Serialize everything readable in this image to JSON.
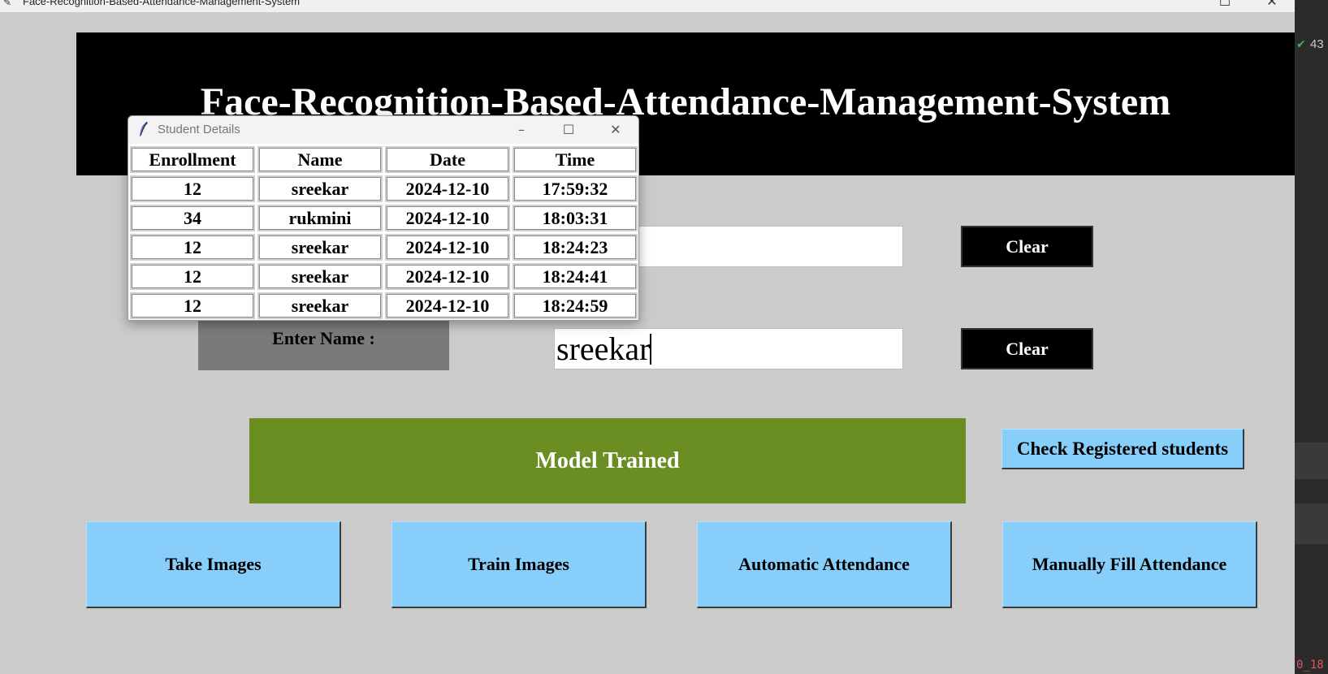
{
  "main_window": {
    "title": "Face-Recognition-Based-Attendance-Management-System",
    "header": "Face-Recognition-Based-Attendance-Management-System",
    "name_label": "Enter Name :",
    "enrollment_value": "",
    "name_value": "sreekar",
    "clear_enrollment_label": "Clear",
    "clear_name_label": "Clear",
    "status_message": "Model Trained",
    "check_registered_label": "Check Registered students",
    "buttons": {
      "take_images": "Take Images",
      "train_images": "Train Images",
      "automatic_attendance": "Automatic Attendance",
      "manual_attendance": "Manually Fill Attendance"
    },
    "colors": {
      "background": "#cbcbcb",
      "header": "#000000",
      "status": "#6b8e23",
      "action_buttons": "#87cefa",
      "label_box": "#7a7a7a"
    }
  },
  "popup": {
    "title": "Student Details",
    "columns": [
      "Enrollment",
      "Name",
      "Date",
      "Time"
    ],
    "rows": [
      [
        "12",
        "sreekar",
        "2024-12-10",
        "17:59:32"
      ],
      [
        "34",
        "rukmini",
        "2024-12-10",
        "18:03:31"
      ],
      [
        "12",
        "sreekar",
        "2024-12-10",
        "18:24:23"
      ],
      [
        "12",
        "sreekar",
        "2024-12-10",
        "18:24:41"
      ],
      [
        "12",
        "sreekar",
        "2024-12-10",
        "18:24:59"
      ]
    ]
  },
  "background_app": {
    "count_text": "43",
    "code_text": "0_18"
  }
}
